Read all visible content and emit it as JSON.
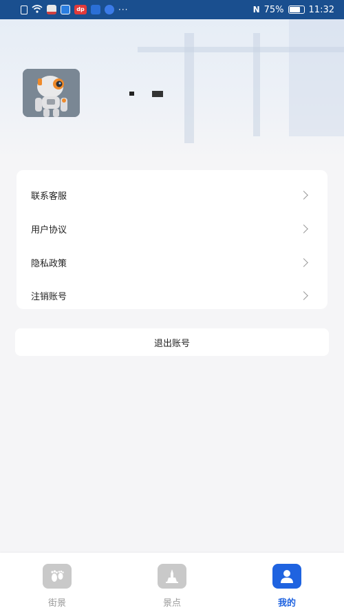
{
  "status_bar": {
    "more": "···",
    "nfc": "N",
    "battery": "75%",
    "time": "11:32"
  },
  "profile": {
    "username": "▪ ▪▪"
  },
  "menu": {
    "items": [
      {
        "label": "联系客服"
      },
      {
        "label": "用户协议"
      },
      {
        "label": "隐私政策"
      },
      {
        "label": "注销账号"
      }
    ]
  },
  "logout": {
    "label": "退出账号"
  },
  "tabs": [
    {
      "label": "街景",
      "icon": "footprint-icon",
      "active": false
    },
    {
      "label": "景点",
      "icon": "landmark-icon",
      "active": false
    },
    {
      "label": "我的",
      "icon": "person-icon",
      "active": true
    }
  ],
  "colors": {
    "status_bar": "#1a4f8f",
    "accent": "#1f63e0",
    "inactive": "#c9c9c9"
  }
}
